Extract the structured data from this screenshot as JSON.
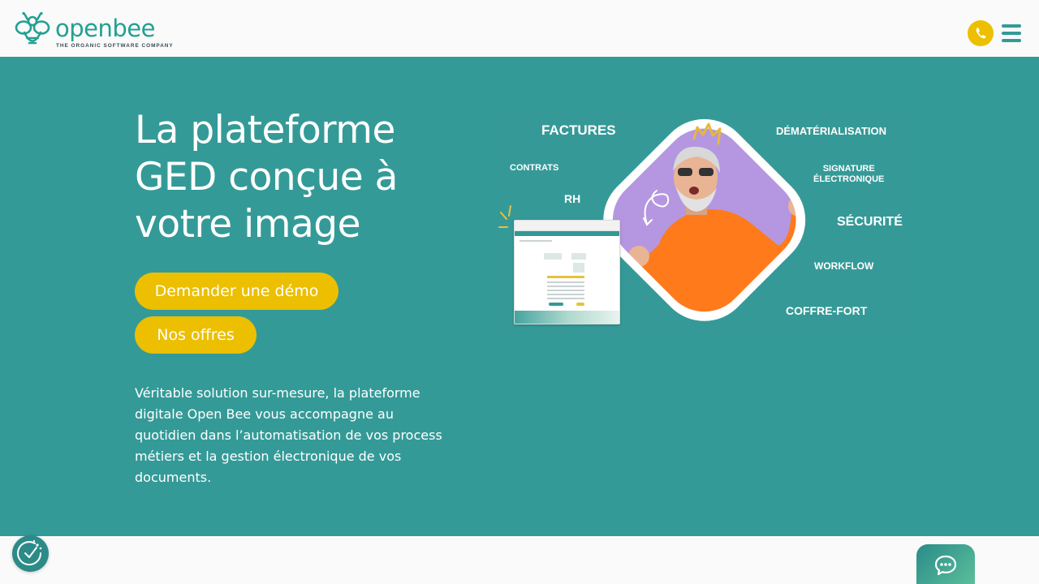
{
  "header": {
    "logo_text": "openbee",
    "logo_tagline": "THE ORGANIC SOFTWARE COMPANY",
    "icons": [
      "bee-logo-icon",
      "phone-icon",
      "hamburger-menu-icon"
    ],
    "colors": {
      "brand_teal": "#23a092",
      "accent_yellow": "#ecbf00"
    }
  },
  "hero": {
    "title": "La plateforme GED conçue à votre image",
    "demo_button": "Demander une démo",
    "offers_button": "Nos offres",
    "description": "Véritable solution sur-mesure, la plateforme digitale Open Bee vous accompagne au quotidien dans l’automatisation de vos process métiers et la gestion électronique de vos documents.",
    "colors": {
      "background": "#349a97",
      "button": "#ecbf00"
    }
  },
  "illustration": {
    "labels": {
      "factures": "FACTURES",
      "contrats": "CONTRATS",
      "rh": "RH",
      "dematerialisation": "DÉMATÉRIALISATION",
      "signature_line1": "SIGNATURE",
      "signature_line2": "ÉLECTRONIQUE",
      "securite": "SÉCURITÉ",
      "workflow": "WORKFLOW",
      "coffre_fort": "COFFRE-FORT"
    },
    "colors": {
      "diamond_fill": "#b497e0",
      "sweater": "#ff7a1a",
      "crown": "#e8b83a"
    }
  },
  "floating": {
    "icons": [
      "cookie-consent-icon",
      "chat-bubble-icon"
    ]
  }
}
